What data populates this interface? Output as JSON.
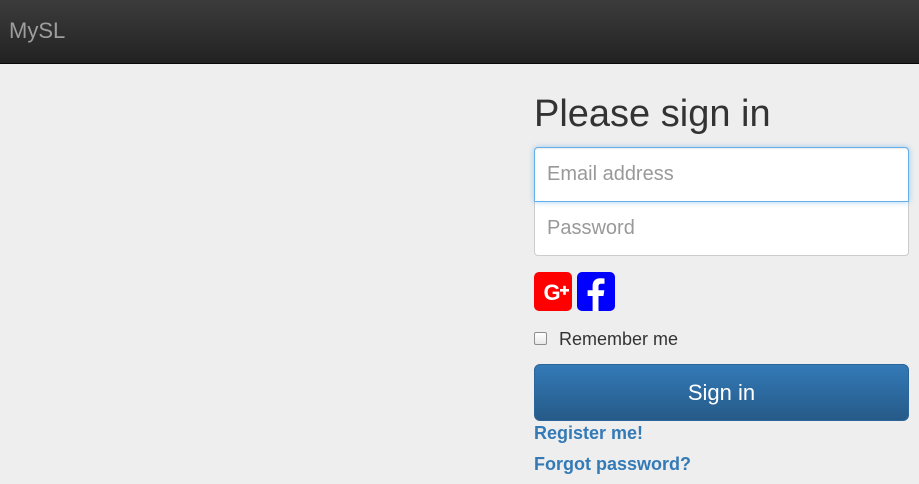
{
  "navbar": {
    "brand": "MySL"
  },
  "signin": {
    "heading": "Please sign in",
    "email_placeholder": "Email address",
    "email_value": "",
    "password_placeholder": "Password",
    "password_value": "",
    "social": [
      {
        "name": "google-plus",
        "icon": "google-plus-icon",
        "color": "#ff0000"
      },
      {
        "name": "facebook",
        "icon": "facebook-icon",
        "color": "#0000ff"
      }
    ],
    "remember_label": "Remember me",
    "remember_checked": false,
    "submit_label": "Sign in",
    "register_link": "Register me!",
    "forgot_link": "Forgot password?"
  },
  "colors": {
    "navbar_bg": "#222222",
    "page_bg": "#eeeeee",
    "primary": "#337ab7",
    "link": "#337ab7"
  }
}
